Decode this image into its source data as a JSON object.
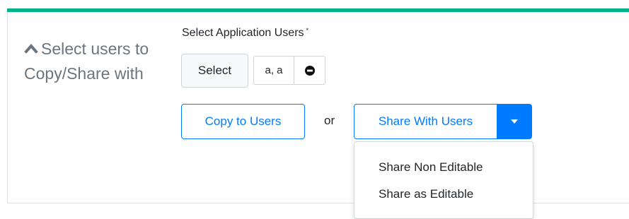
{
  "section": {
    "heading": "Select users to Copy/Share with",
    "collapse_icon": "chevron-up-icon"
  },
  "users_field": {
    "label": "Select Application Users",
    "required_marker": "*",
    "select_button_label": "Select",
    "selected_chip": {
      "text": "a, a",
      "remove_icon": "minus-circle-icon"
    }
  },
  "actions": {
    "copy_button_label": "Copy to Users",
    "or_text": "or",
    "share_button_label": "Share With Users",
    "share_toggle_icon": "caret-down-icon",
    "share_menu": [
      {
        "label": "Share Non Editable"
      },
      {
        "label": "Share as Editable"
      }
    ]
  },
  "colors": {
    "accent_bar": "#00b288",
    "primary": "#007bff",
    "muted_text": "#6c757d"
  }
}
